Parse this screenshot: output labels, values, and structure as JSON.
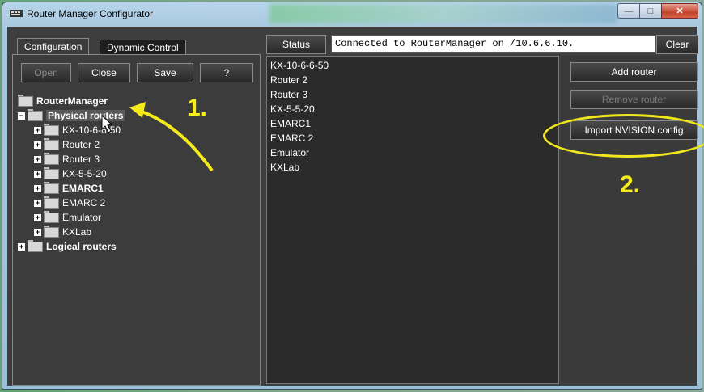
{
  "window": {
    "title": "Router Manager Configurator",
    "controls": {
      "minimize": "—",
      "maximize": "□",
      "close": "✕"
    }
  },
  "tabs": [
    {
      "label": "Configuration"
    },
    {
      "label": "Dynamic Control"
    }
  ],
  "toolbar": {
    "open_label": "Open",
    "close_label": "Close",
    "save_label": "Save",
    "help_label": "?"
  },
  "tree": {
    "root": "RouterManager",
    "physical": "Physical routers",
    "physical_children": [
      "KX-10-6-6-50",
      "Router 2",
      "Router 3",
      "KX-5-5-20",
      "EMARC1",
      "EMARC 2",
      "Emulator",
      "KXLab"
    ],
    "logical": "Logical routers"
  },
  "status": {
    "button_label": "Status",
    "message": "Connected to RouterManager on /10.6.6.10.",
    "clear_label": "Clear"
  },
  "router_list": [
    "KX-10-6-6-50",
    "Router 2",
    "Router 3",
    "KX-5-5-20",
    "EMARC1",
    "EMARC 2",
    "Emulator",
    "KXLab"
  ],
  "actions": {
    "add_label": "Add router",
    "remove_label": "Remove router",
    "import_label": "Import NVISION config"
  },
  "annotations": {
    "step1": "1.",
    "step2": "2."
  },
  "colors": {
    "annotation": "#f5ea1a",
    "panel_bg": "#3c3c3c"
  }
}
